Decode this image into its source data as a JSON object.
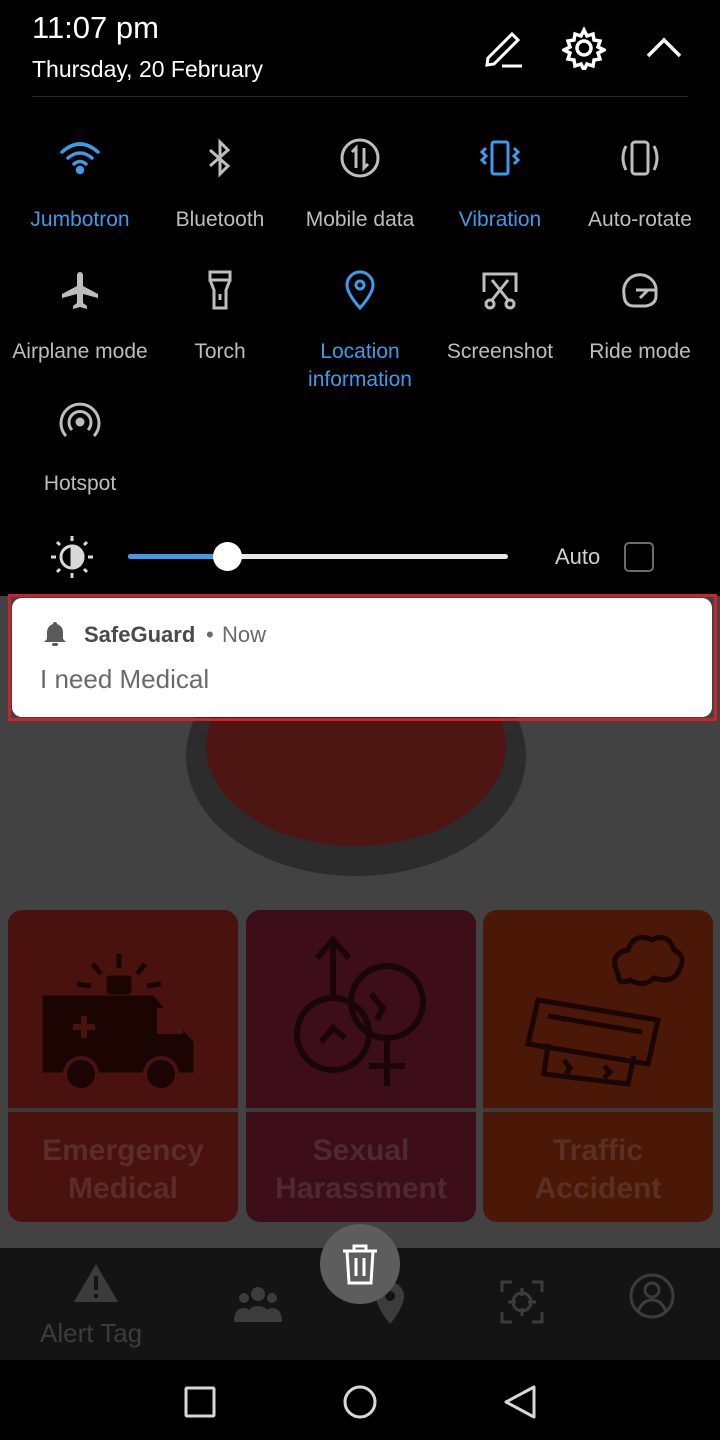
{
  "status": {
    "time": "11:07 pm",
    "date": "Thursday, 20 February"
  },
  "header_icons": [
    "edit-icon",
    "settings-icon",
    "collapse-icon"
  ],
  "quick_settings": [
    {
      "label": "Jumbotron",
      "icon": "wifi-icon",
      "active": true
    },
    {
      "label": "Bluetooth",
      "icon": "bluetooth-icon",
      "active": false
    },
    {
      "label": "Mobile data",
      "icon": "mobile-data-icon",
      "active": false
    },
    {
      "label": "Vibration",
      "icon": "vibration-icon",
      "active": true
    },
    {
      "label": "Auto-rotate",
      "icon": "auto-rotate-icon",
      "active": false
    },
    {
      "label": "Airplane mode",
      "icon": "airplane-icon",
      "active": false
    },
    {
      "label": "Torch",
      "icon": "torch-icon",
      "active": false
    },
    {
      "label": "Location information",
      "label_line1": "Location",
      "label_line2": "information",
      "icon": "location-icon",
      "active": true
    },
    {
      "label": "Screenshot",
      "icon": "screenshot-icon",
      "active": false
    },
    {
      "label": "Ride mode",
      "icon": "ride-mode-icon",
      "active": false
    },
    {
      "label": "Hotspot",
      "icon": "hotspot-icon",
      "active": false
    }
  ],
  "brightness": {
    "level": 0.26,
    "auto_label": "Auto",
    "auto_checked": false
  },
  "notification": {
    "app": "SafeGuard",
    "separator": "•",
    "time": "Now",
    "message": "I need Medical"
  },
  "background_app": {
    "cards": [
      {
        "line1": "Emergency",
        "line2": "Medical",
        "icon": "ambulance-icon"
      },
      {
        "line1": "Sexual",
        "line2": "Harassment",
        "icon": "gender-symbols-icon"
      },
      {
        "line1": "Traffic",
        "line2": "Accident",
        "icon": "overturned-car-icon"
      }
    ],
    "bottom_nav": {
      "alert_label": "Alert Tag"
    }
  },
  "colors": {
    "accent": "#3d9be9",
    "highlight_outline": "#d0202a",
    "inactive_text": "#bdbdbd"
  }
}
